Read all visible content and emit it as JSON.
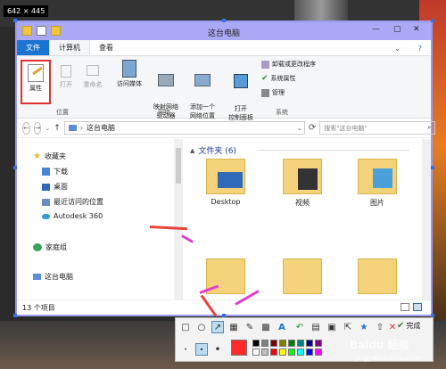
{
  "dimensions": "642 × 445",
  "window": {
    "title": "这台电脑",
    "tabs": [
      "文件",
      "计算机",
      "查看"
    ],
    "help": "?"
  },
  "ribbon": {
    "location": {
      "label": "位置",
      "properties": "属性",
      "open": "打开",
      "rename": "重命名"
    },
    "network": {
      "label": "网络",
      "media": "访问媒体",
      "map_drive": "映射网络\n驱动器",
      "add_location": "添加一个\n网络位置"
    },
    "system": {
      "label": "系统",
      "control_panel": "打开\n控制面板",
      "uninstall": "卸载或更改程序",
      "sys_props": "系统属性",
      "manage": "管理"
    }
  },
  "address": {
    "path": "这台电脑",
    "search_placeholder": "搜索\"这台电脑\""
  },
  "nav": {
    "favorites": "收藏夹",
    "items": [
      "下载",
      "桌面",
      "最近访问的位置",
      "Autodesk 360"
    ],
    "homegroup": "家庭组",
    "this_pc": "这台电脑"
  },
  "content": {
    "group": "文件夹 (6)",
    "folders": [
      "Desktop",
      "视频",
      "图片"
    ]
  },
  "status": "13 个项目",
  "capture_toolbar": {
    "done": "完成",
    "colors": [
      "#000000",
      "#808080",
      "#800000",
      "#808000",
      "#008000",
      "#008080",
      "#000080",
      "#800080",
      "#ffffff",
      "#c0c0c0",
      "#ff0000",
      "#ffff00",
      "#00ff00",
      "#00ffff",
      "#0000ff",
      "#ff00ff"
    ]
  },
  "watermark": {
    "brand": "Baidu 经验",
    "url": "jingyan.baidu.com"
  },
  "colors": {
    "accent": "#1a74d0",
    "title_bar": "#a9a9f5",
    "annotation_red": "#e8433a",
    "annotation_magenta": "#e23ad0"
  }
}
